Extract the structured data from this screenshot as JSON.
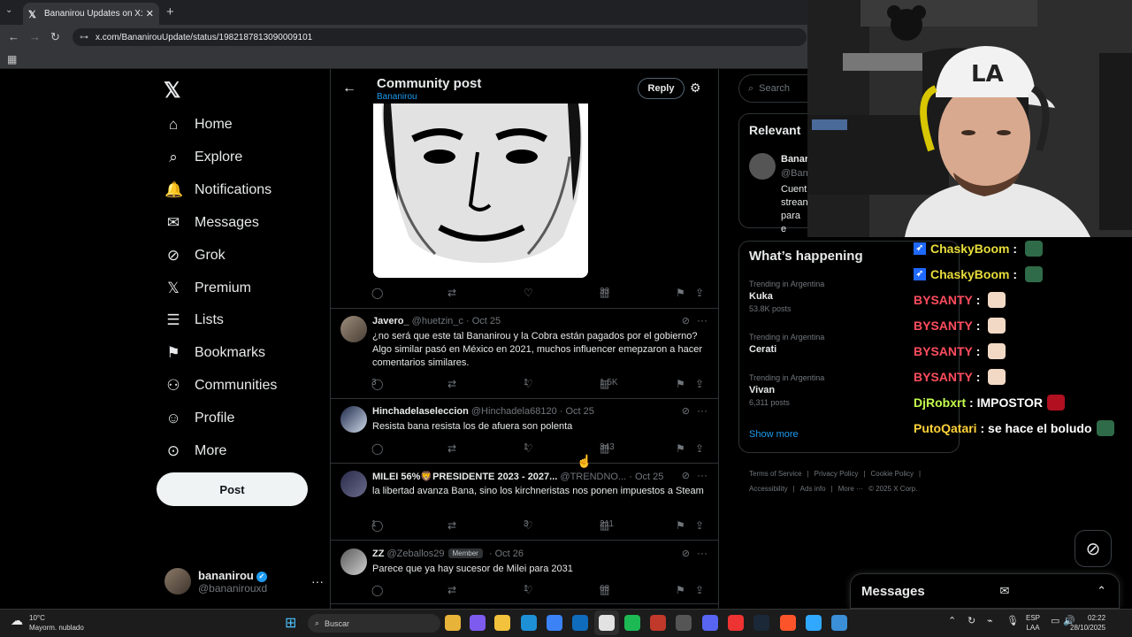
{
  "browser": {
    "tab_title": "Bananirou Updates on X: \"Ban",
    "url": "x.com/BananirouUpdate/status/1982187813090009101"
  },
  "nav": {
    "items": [
      {
        "label": "Home",
        "icon": "home-icon"
      },
      {
        "label": "Explore",
        "icon": "search-icon"
      },
      {
        "label": "Notifications",
        "icon": "bell-icon"
      },
      {
        "label": "Messages",
        "icon": "envelope-icon"
      },
      {
        "label": "Grok",
        "icon": "grok-icon"
      },
      {
        "label": "Premium",
        "icon": "x-logo-icon"
      },
      {
        "label": "Lists",
        "icon": "list-icon"
      },
      {
        "label": "Bookmarks",
        "icon": "bookmark-icon"
      },
      {
        "label": "Communities",
        "icon": "people-icon"
      },
      {
        "label": "Profile",
        "icon": "person-icon"
      },
      {
        "label": "More",
        "icon": "more-circle-icon"
      }
    ],
    "post_label": "Post",
    "account": {
      "name": "bananirou",
      "handle": "@bananirouxd"
    }
  },
  "header": {
    "title": "Community post",
    "subtitle": "Bananirou",
    "reply_label": "Reply"
  },
  "post": {
    "views": "33"
  },
  "replies": [
    {
      "name": "Javero_",
      "handle": "@huetzin_c",
      "date": "Oct 25",
      "text": "¿no será que este tal Bananirou y la Cobra están pagados por el gobierno? Algo similar pasó en México en 2021, muchos influencer emepzaron a hacer comentarios similares.",
      "replies": "3",
      "retweets": "",
      "likes": "1",
      "views": "1.5K"
    },
    {
      "name": "Hinchadelaseleccion",
      "handle": "@Hinchadela68120",
      "date": "Oct 25",
      "text": "Resista bana resista los de afuera son polenta",
      "replies": "",
      "retweets": "",
      "likes": "1",
      "views": "343"
    },
    {
      "name": "MILEI 56%🦁PRESIDENTE 2023 - 2027...",
      "handle": "@TRENDNO...",
      "date": "Oct 25",
      "text": "la libertad avanza Bana, sino los kirchneristas nos ponen impuestos a Steam",
      "replies": "1",
      "retweets": "",
      "likes": "3",
      "views": "211"
    },
    {
      "name": "ZZ",
      "handle": "@Zeballos29",
      "badge": "Member",
      "date": "Oct 26",
      "text": "Parece que ya hay sucesor de Milei para 2031",
      "replies": "",
      "retweets": "",
      "likes": "1",
      "views": "68"
    }
  ],
  "right": {
    "search_placeholder": "Search",
    "relevant_title": "Relevant",
    "relevant_name": "Banar",
    "relevant_handle": "@Ban",
    "relevant_bio": "Cuent strean para e",
    "happening_title": "What’s happening",
    "trends": [
      {
        "context": "Trending in Argentina",
        "name": "Kuka",
        "count": "53.8K posts"
      },
      {
        "context": "Trending in Argentina",
        "name": "Cerati",
        "count": ""
      },
      {
        "context": "Trending in Argentina",
        "name": "Vivan",
        "count": "6,311 posts"
      }
    ],
    "show_more": "Show more",
    "footer": [
      "Terms of Service",
      "|",
      "Privacy Policy",
      "|",
      "Cookie Policy",
      "|",
      "Accessibility",
      "|",
      "Ads info",
      "|",
      "More ···",
      "© 2025 X Corp."
    ]
  },
  "messages_dock": {
    "title": "Messages"
  },
  "chat": [
    {
      "user": "ChaskyBoom",
      "color": "#e8de3a",
      "msg": "",
      "emote": "#2f6b48",
      "prime": true
    },
    {
      "user": "ChaskyBoom",
      "color": "#e8de3a",
      "msg": "",
      "emote": "#2f6b48",
      "prime": true
    },
    {
      "user": "BYSANTY",
      "color": "#ff4d5e",
      "msg": "",
      "emote": "#f1d9c6",
      "prime": false
    },
    {
      "user": "BYSANTY",
      "color": "#ff4d5e",
      "msg": "",
      "emote": "#f1d9c6",
      "prime": false
    },
    {
      "user": "BYSANTY",
      "color": "#ff4d5e",
      "msg": "",
      "emote": "#f1d9c6",
      "prime": false
    },
    {
      "user": "BYSANTY",
      "color": "#ff4d5e",
      "msg": "",
      "emote": "#f1d9c6",
      "prime": false
    },
    {
      "user": "DjRobxrt",
      "color": "#c4ff4d",
      "msg": "IMPOSTOR",
      "emote": "#b01020",
      "prime": false
    },
    {
      "user": "PutoQatari",
      "color": "#ffd23a",
      "msg": "se hace el boludo",
      "emote": "#2f6b48",
      "prime": false
    }
  ],
  "taskbar": {
    "weather_temp": "10°C",
    "weather_desc": "Mayorm. nublado",
    "search_label": "Buscar",
    "lang1": "ESP",
    "lang2": "LAA",
    "time": "02:22",
    "date": "28/10/2025"
  },
  "colors": {
    "accent": "#1d9bf0",
    "border": "#2f3336",
    "muted": "#71767b"
  }
}
